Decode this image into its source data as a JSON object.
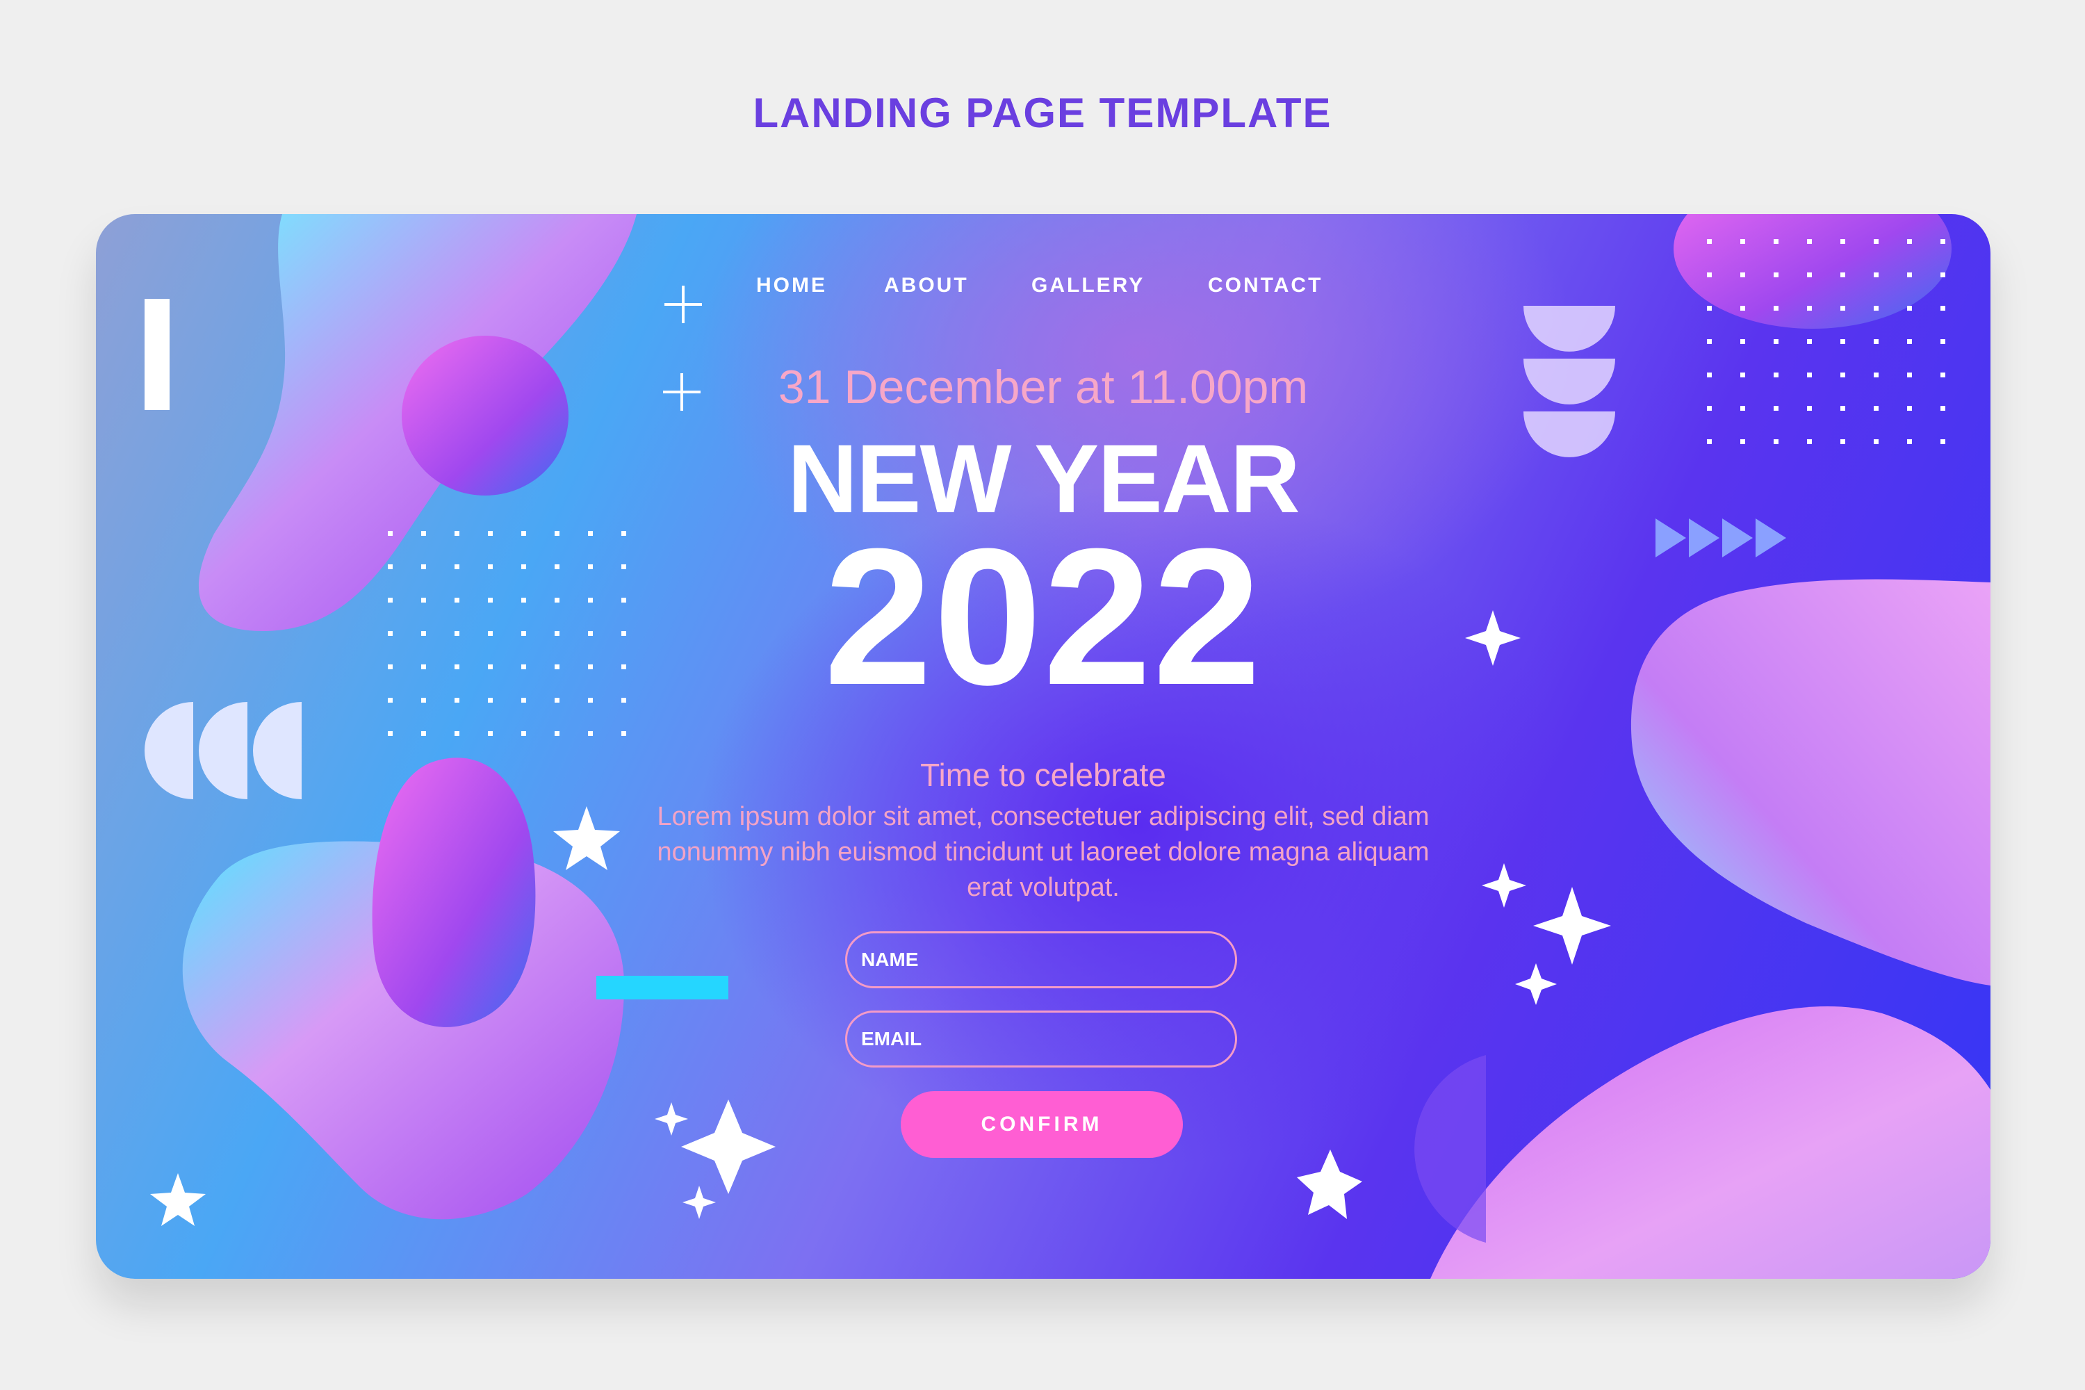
{
  "page": {
    "heading": "LANDING PAGE TEMPLATE"
  },
  "nav": {
    "items": [
      {
        "label": "HOME"
      },
      {
        "label": "ABOUT"
      },
      {
        "label": "GALLERY"
      },
      {
        "label": "CONTACT"
      }
    ]
  },
  "hero": {
    "date": "31 December at 11.00pm",
    "title": "NEW YEAR",
    "year": "2022",
    "tagline": "Time to celebrate",
    "body": "Lorem ipsum dolor sit amet, consectetuer adipiscing elit, sed diam nonummy nibh euismod tincidunt ut laoreet dolore magna aliquam erat volutpat."
  },
  "form": {
    "name_placeholder": "NAME",
    "email_placeholder": "EMAIL",
    "confirm_label": "CONFIRM"
  },
  "colors": {
    "heading": "#6a3fe0",
    "accent_pink": "#f7a7c8",
    "button": "#ff5ed3",
    "text_white": "#ffffff"
  },
  "icons": [
    "plus-icon",
    "sparkle-icon",
    "star-icon",
    "triangle-arrow-icon"
  ]
}
